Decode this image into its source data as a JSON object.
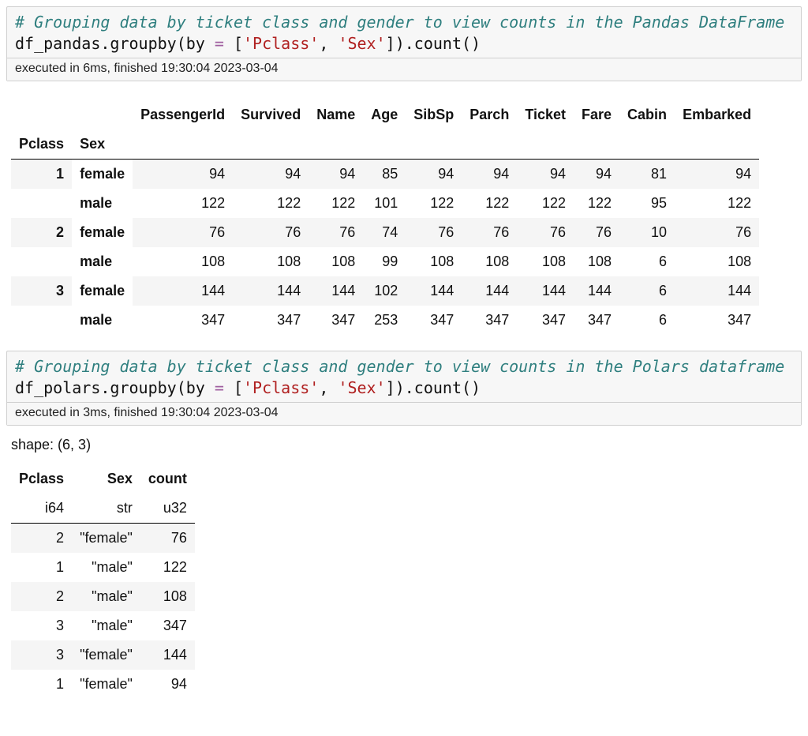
{
  "cell_a": {
    "comment": "# Grouping data by ticket class and gender to view counts in the Pandas DataFrame",
    "code_prefix": "df_pandas",
    "code_method": ".groupby(by ",
    "code_eq": "=",
    "code_mid1": " [",
    "code_str1": "'Pclass'",
    "code_comma": ", ",
    "code_str2": "'Sex'",
    "code_tail": "]).count()",
    "exec": "executed in 6ms, finished 19:30:04 2023-03-04"
  },
  "pandas_table": {
    "index_names": [
      "Pclass",
      "Sex"
    ],
    "columns": [
      "PassengerId",
      "Survived",
      "Name",
      "Age",
      "SibSp",
      "Parch",
      "Ticket",
      "Fare",
      "Cabin",
      "Embarked"
    ],
    "rows": [
      {
        "idx": [
          "1",
          "female"
        ],
        "vals": [
          94,
          94,
          94,
          85,
          94,
          94,
          94,
          94,
          81,
          94
        ]
      },
      {
        "idx": [
          "",
          "male"
        ],
        "vals": [
          122,
          122,
          122,
          101,
          122,
          122,
          122,
          122,
          95,
          122
        ]
      },
      {
        "idx": [
          "2",
          "female"
        ],
        "vals": [
          76,
          76,
          76,
          74,
          76,
          76,
          76,
          76,
          10,
          76
        ]
      },
      {
        "idx": [
          "",
          "male"
        ],
        "vals": [
          108,
          108,
          108,
          99,
          108,
          108,
          108,
          108,
          6,
          108
        ]
      },
      {
        "idx": [
          "3",
          "female"
        ],
        "vals": [
          144,
          144,
          144,
          102,
          144,
          144,
          144,
          144,
          6,
          144
        ]
      },
      {
        "idx": [
          "",
          "male"
        ],
        "vals": [
          347,
          347,
          347,
          253,
          347,
          347,
          347,
          347,
          6,
          347
        ]
      }
    ]
  },
  "cell_b": {
    "comment": "# Grouping data by ticket class and gender to view counts in the Polars dataframe",
    "code_prefix": "df_polars",
    "code_method": ".groupby(by ",
    "code_eq": "=",
    "code_mid1": " [",
    "code_str1": "'Pclass'",
    "code_comma": ", ",
    "code_str2": "'Sex'",
    "code_tail": "]).count()",
    "exec": "executed in 3ms, finished 19:30:04 2023-03-04"
  },
  "polars_shape": "shape: (6, 3)",
  "polars_table": {
    "columns": [
      "Pclass",
      "Sex",
      "count"
    ],
    "dtypes": [
      "i64",
      "str",
      "u32"
    ],
    "rows": [
      [
        2,
        "\"female\"",
        76
      ],
      [
        1,
        "\"male\"",
        122
      ],
      [
        2,
        "\"male\"",
        108
      ],
      [
        3,
        "\"male\"",
        347
      ],
      [
        3,
        "\"female\"",
        144
      ],
      [
        1,
        "\"female\"",
        94
      ]
    ]
  }
}
